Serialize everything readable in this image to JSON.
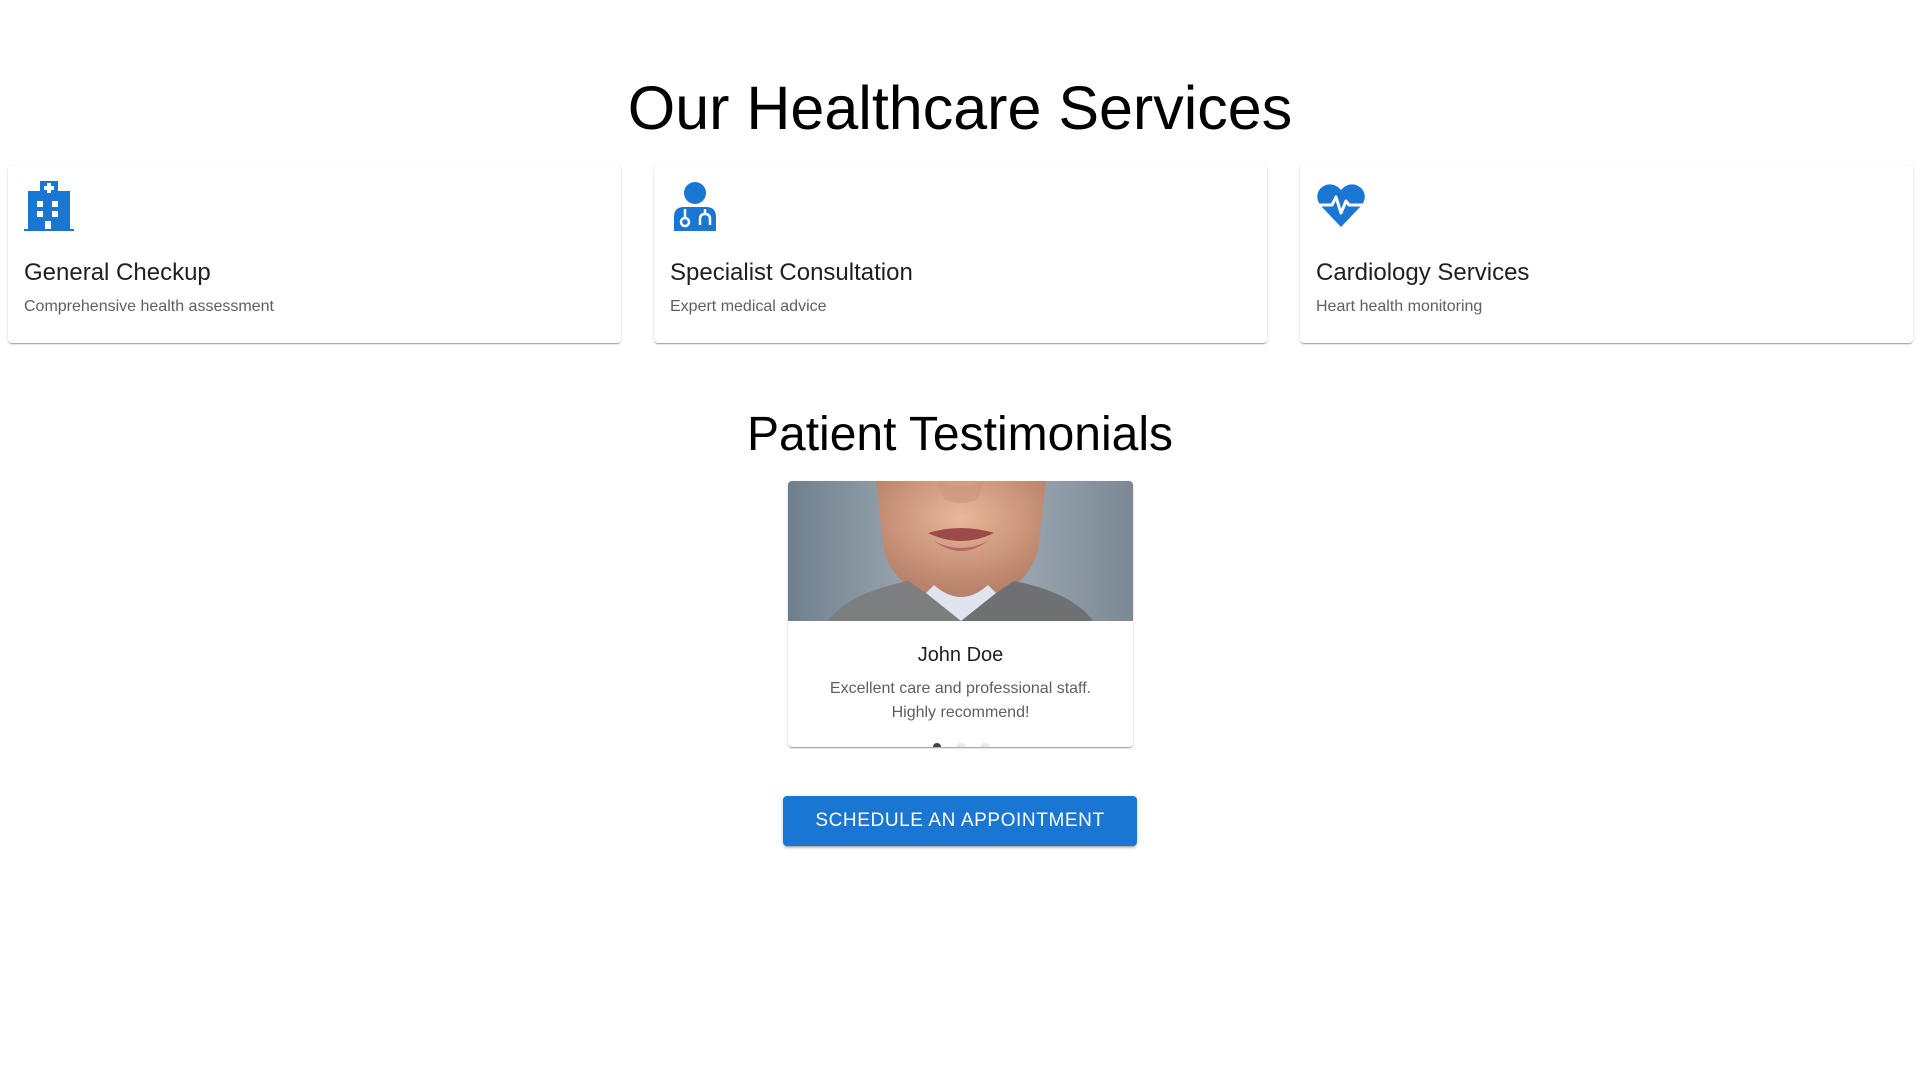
{
  "services": {
    "title": "Our Healthcare Services",
    "items": [
      {
        "icon": "hospital-icon",
        "title": "General Checkup",
        "description": "Comprehensive health assessment"
      },
      {
        "icon": "doctor-icon",
        "title": "Specialist Consultation",
        "description": "Expert medical advice"
      },
      {
        "icon": "heart-pulse-icon",
        "title": "Cardiology Services",
        "description": "Heart health monitoring"
      }
    ]
  },
  "testimonials": {
    "title": "Patient Testimonials",
    "current": {
      "name": "John Doe",
      "quote": "Excellent care and professional staff. Highly recommend!"
    },
    "slide_count": 3,
    "active_index": 0
  },
  "cta": {
    "label": "Schedule an Appointment"
  },
  "colors": {
    "primary": "#1976d2",
    "background": "#ffffff",
    "text_primary": "#1f1f1f",
    "text_secondary": "#5f5f5f"
  }
}
